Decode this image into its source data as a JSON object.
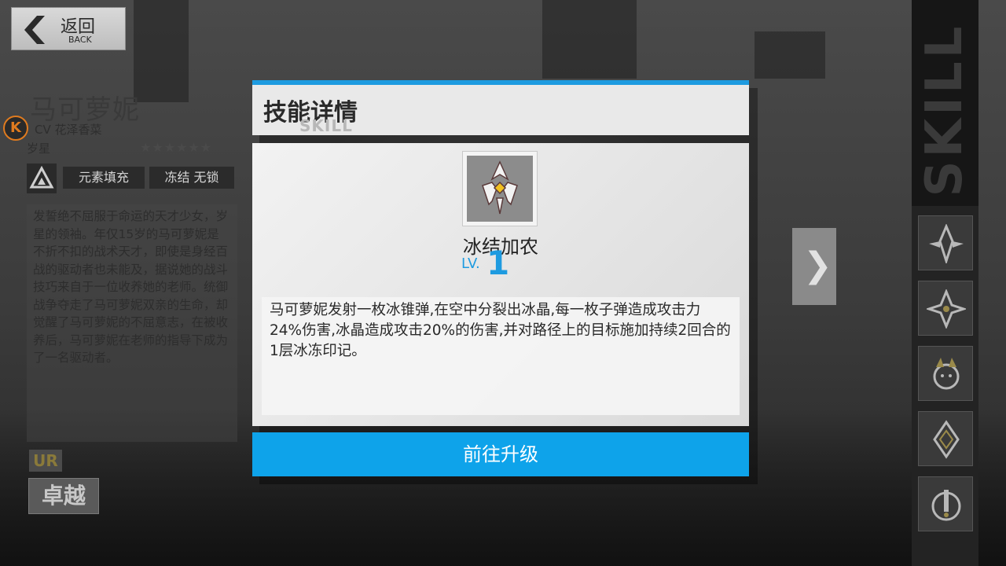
{
  "back": {
    "label": "返回",
    "sublabel": "BACK"
  },
  "character": {
    "name": "马可萝妮",
    "cv": "CV 花泽香菜",
    "faction_icon_letter": "K",
    "faction": "岁星",
    "stars": "★★★★★★",
    "tags": [
      "元素填充",
      "冻结 无锁"
    ],
    "description": "发誓绝不屈服于命运的天才少女，岁星的领袖。年仅15岁的马可萝妮是不折不扣的战术天才，即使是身经百战的驱动者也未能及，据说她的战斗技巧来自于一位收养她的老师。统御战争夺走了马可萝妮双亲的生命，却觉醒了马可萝妮的不屈意志，在被收养后，马可萝妮在老师的指导下成为了一名驱动者。",
    "rarity": "UR",
    "grade": "卓越"
  },
  "dialog": {
    "title": "技能详情",
    "subtitle": "SKILL",
    "skill_name": "冰结加农",
    "level_label": "LV.",
    "level": "1",
    "skill_description": "马可萝妮发射一枚冰锥弹,在空中分裂出冰晶,每一枚子弹造成攻击力24%伤害,冰晶造成攻击20%的伤害,并对路径上的目标施加持续2回合的1层冰冻印记。",
    "upgrade_button": "前往升级"
  },
  "sidebar": {
    "title": "SKILL",
    "slots": [
      "skill-slot-1",
      "skill-slot-2",
      "skill-slot-3",
      "skill-slot-4",
      "skill-slot-5"
    ]
  },
  "colors": {
    "accent": "#0ea3ea",
    "orange": "#e07b1f"
  }
}
